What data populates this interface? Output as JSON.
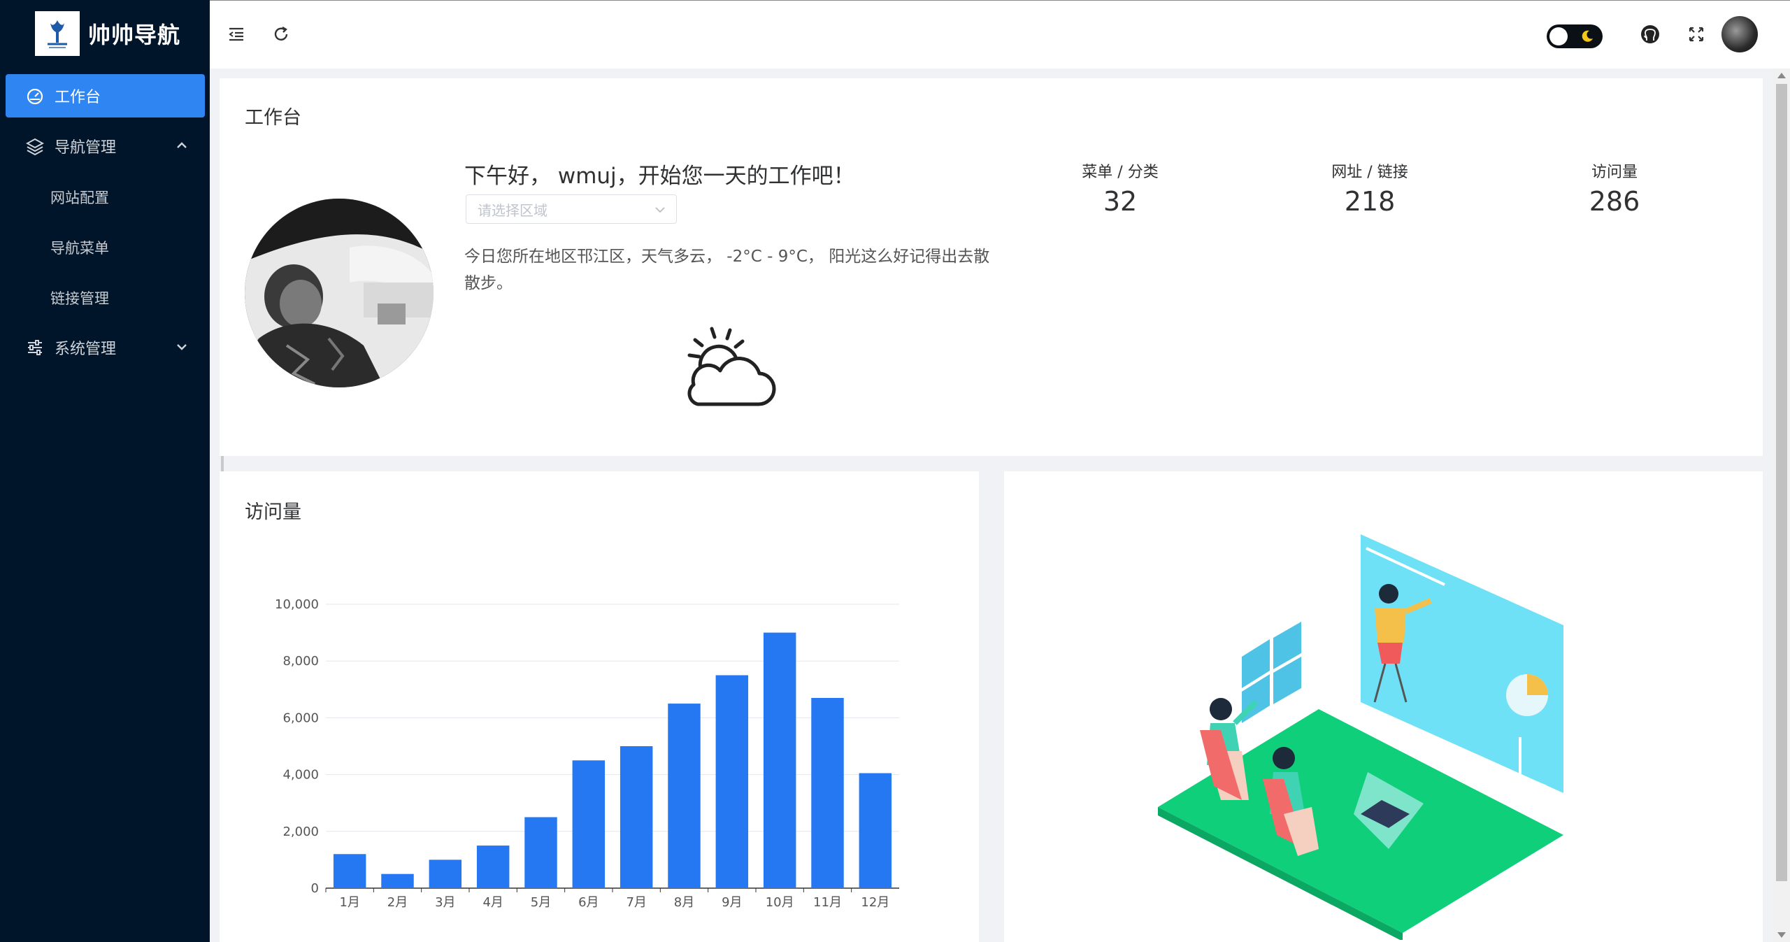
{
  "colors": {
    "sidebar_bg": "#001529",
    "accent": "#2f85f2",
    "bar": "#2578f2"
  },
  "sidebar": {
    "logo_text": "帅帅导航",
    "logo_icon": "tree-logo-icon",
    "items": [
      {
        "label": "工作台",
        "icon": "dashboard-icon",
        "active": true
      },
      {
        "label": "导航管理",
        "icon": "layers-icon",
        "expanded": true,
        "children": [
          "网站配置",
          "导航菜单",
          "链接管理"
        ]
      },
      {
        "label": "系统管理",
        "icon": "sliders-icon",
        "expanded": false
      }
    ]
  },
  "header": {
    "icons": [
      "collapse-menu-icon",
      "refresh-icon",
      "theme-toggle",
      "github-icon",
      "fullscreen-icon",
      "user-avatar"
    ]
  },
  "workbench": {
    "title": "工作台",
    "greeting": "下午好， wmuj，开始您一天的工作吧！",
    "region_placeholder": "请选择区域",
    "weather": "今日您所在地区邗江区，天气多云， -2°C - 9°C， 阳光这么好记得出去散散步。",
    "weather_icon": "partly-cloudy-icon",
    "stats": [
      {
        "label": "菜单 / 分类",
        "value": "32"
      },
      {
        "label": "网址 / 链接",
        "value": "218"
      },
      {
        "label": "访问量",
        "value": "286"
      }
    ]
  },
  "visits_card": {
    "title": "访问量"
  },
  "chart_data": {
    "type": "bar",
    "categories": [
      "1月",
      "2月",
      "3月",
      "4月",
      "5月",
      "6月",
      "7月",
      "8月",
      "9月",
      "10月",
      "11月",
      "12月"
    ],
    "values": [
      1200,
      500,
      1000,
      1500,
      2500,
      4500,
      5000,
      6500,
      7500,
      9000,
      6700,
      4050
    ],
    "yticks": [
      "0",
      "2,000",
      "4,000",
      "6,000",
      "8,000",
      "10,000"
    ],
    "ylim": [
      0,
      10000
    ],
    "grid": true
  },
  "illustration": {
    "name": "presentation-illustration"
  }
}
